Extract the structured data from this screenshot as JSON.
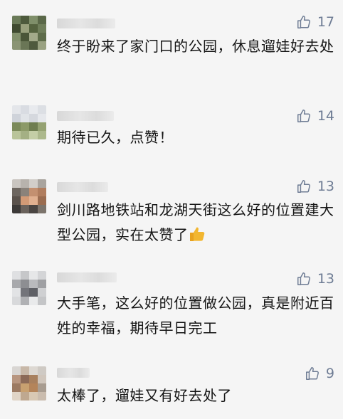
{
  "comments": [
    {
      "text": "终于盼来了家门口的公园，休息遛娃好去处",
      "likes": "17",
      "emoji": false
    },
    {
      "text": "期待已久，点赞！",
      "likes": "14",
      "emoji": false
    },
    {
      "text": "剑川路地铁站和龙湖天街这么好的位置建大型公园，实在太赞了",
      "likes": "13",
      "emoji": true
    },
    {
      "text": "大手笔，这么好的位置做公园，真是附近百姓的幸福，期待早日完工",
      "likes": "13",
      "emoji": false
    },
    {
      "text": "太棒了，遛娃又有好去处了",
      "likes": "9",
      "emoji": false
    }
  ],
  "icons": {
    "like": "thumbs-up-icon",
    "emoji": "thumbs-up-emoji"
  },
  "colors": {
    "like": "#6e7c94",
    "text": "#151515",
    "background": "#f5f5f5",
    "emoji": "#f2b630"
  }
}
